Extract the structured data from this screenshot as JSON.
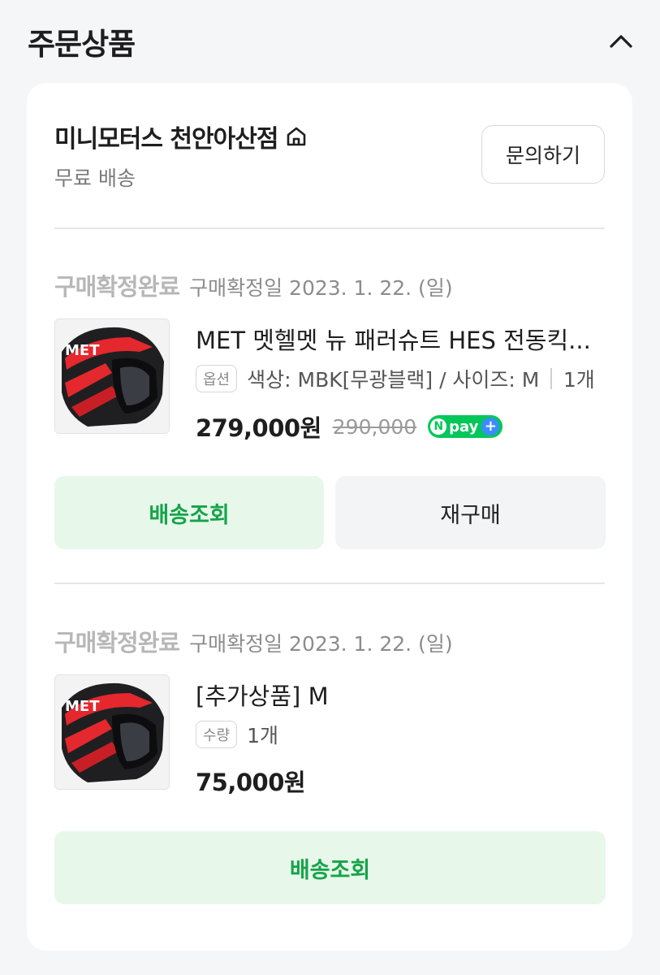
{
  "header": {
    "title": "주문상품",
    "collapse_icon": "chevron-up-icon"
  },
  "store": {
    "name": "미니모터스 천안아산점",
    "home_icon": "home-icon",
    "shipping": "무료 배송",
    "inquire_label": "문의하기"
  },
  "items": [
    {
      "status": "구매확정완료",
      "confirm_date": "구매확정일 2023. 1. 22. (일)",
      "name": "MET 멧헬멧 뉴 패러슈트 HES 전동킥...",
      "tag": "옵션",
      "option": "색상: MBK[무광블랙] / 사이즈: M",
      "quantity": "1개",
      "price": "279,000원",
      "original_price": "290,000",
      "badge": {
        "n": "N",
        "pay": "pay",
        "plus": "+"
      },
      "buttons": [
        "배송조회",
        "재구매"
      ]
    },
    {
      "status": "구매확정완료",
      "confirm_date": "구매확정일 2023. 1. 22. (일)",
      "name": "[추가상품] M",
      "tag": "수량",
      "quantity": "1개",
      "price": "75,000원",
      "buttons": [
        "배송조회"
      ]
    }
  ],
  "colors": {
    "accent_green": "#16a34a",
    "green_bg": "#e7f8ea",
    "npay_green": "#03c75a"
  }
}
